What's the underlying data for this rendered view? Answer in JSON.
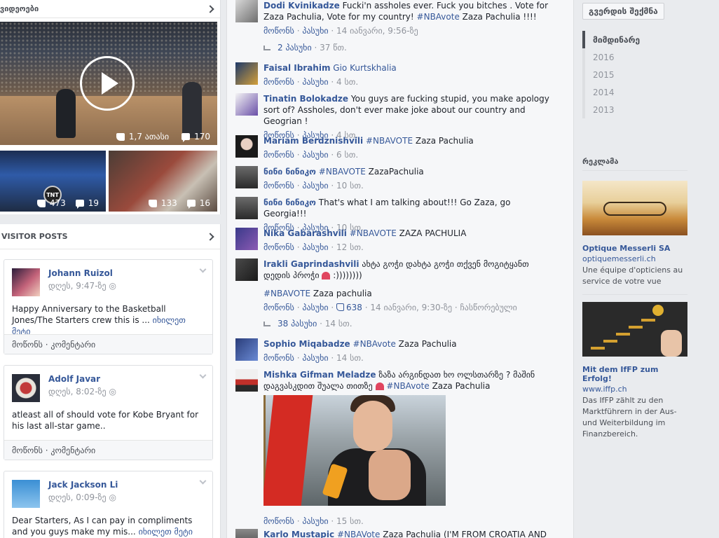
{
  "videos": {
    "section_title": "ვიდეოები",
    "main": {
      "likes": "1,7 ათასი",
      "comments": "170"
    },
    "small": [
      {
        "likes": "473",
        "comments": "19"
      },
      {
        "likes": "133",
        "comments": "16"
      }
    ],
    "tnt_label": "TNT"
  },
  "visitor_posts": {
    "section_title": "VISITOR POSTS",
    "posts": [
      {
        "author": "Johann Ruizol",
        "time": "დღეს, 9:47-ზე",
        "text": "Happy Anniversary to the Basketball Jones/The Starters crew this is ...",
        "see_more": "იხილეთ მეტი",
        "like": "მოწონს",
        "comment": "კომენტარი"
      },
      {
        "author": "Adolf Javar",
        "time": "დღეს, 8:02-ზე",
        "text": "atleast all of should vote for Kobe Bryant for his last all-star game..",
        "see_more": "",
        "like": "მოწონს",
        "comment": "კომენტარი"
      },
      {
        "author": "Jack Jackson Li",
        "time": "დღეს, 0:09-ზე",
        "text": "Dear Starters, As I can pay in compliments and you guys make my mis...",
        "see_more": "იხილეთ მეტი",
        "like": "მოწონს",
        "comment": "კომენტარი"
      }
    ]
  },
  "comments": [
    {
      "name": "Dodi Kvinikadze",
      "tag": "",
      "text": "Fucki'n assholes ever. Fuck you bitches . Vote for Zaza Pachulia, Vote for my country!",
      "tag2": "#NBAvote",
      "text2": "Zaza Pachulia !!!!",
      "actions": {
        "like": "მოწონს",
        "reply": "პასუხი",
        "meta": "14 იანვარი, 9:56-ზე"
      },
      "replies": "2 პასუხი",
      "replies_time": "37 წთ."
    },
    {
      "name": "Faisal Ibrahim",
      "tag": "Gio Kurtskhalia",
      "text": "",
      "actions": {
        "like": "მოწონს",
        "reply": "პასუხი",
        "meta": "4 სთ."
      }
    },
    {
      "name": "Tinatin Bolokadze",
      "tag": "",
      "text": "You guys are fucking stupid, you make apology sort of? Assholes, don't ever make joke about our country and Geogrian !",
      "actions": {
        "like": "მოწონს",
        "reply": "პასუხი",
        "meta": "4 სთ."
      }
    },
    {
      "name": "Mariam Berdznishvili",
      "tag": "#NBAVOTE",
      "text": "Zaza Pachulia",
      "actions": {
        "like": "მოწონს",
        "reply": "პასუხი",
        "meta": "6 სთ."
      }
    },
    {
      "name": "ნინი ნინიკო",
      "tag": "#NBAVOTE",
      "text": "ZazaPachulia",
      "actions": {
        "like": "მოწონს",
        "reply": "პასუხი",
        "meta": "10 სთ."
      }
    },
    {
      "name": "ნინი ნინიკო",
      "tag": "",
      "text": "That's what I am talking about!!! Go Zaza, go Georgia!!!",
      "actions": {
        "like": "მოწონს",
        "reply": "პასუხი",
        "meta": "10 სთ."
      }
    },
    {
      "name": "Nika Gabarashvili",
      "tag": "#NBAVOTE",
      "text": "ZAZA PACHULIA",
      "actions": {
        "like": "მოწონს",
        "reply": "პასუხი",
        "meta": "12 სთ."
      }
    },
    {
      "name": "Irakli Gaprindashvili",
      "tag": "",
      "text": "ახტა გოჭი დახტა გოჭი თქვენ მოგიტყანთ დედის პროჭი",
      "text_after_heart": ":))))))))",
      "tag2": "#NBAVOTE",
      "text2": "Zaza pachulia",
      "actions": {
        "like": "მოწონს",
        "reply": "პასუხი",
        "likes": "638",
        "meta": "14 იანვარი, 9:30-ზე",
        "edited": "ჩასწორებული"
      },
      "replies": "38 პასუხი",
      "replies_time": "14 სთ."
    },
    {
      "name": "Sophio Miqabadze",
      "tag": "#NBAvote",
      "text": "Zaza Pachulia",
      "actions": {
        "like": "მოწონს",
        "reply": "პასუხი",
        "meta": "14 სთ."
      }
    },
    {
      "name": "Mishka Gifman Meladze",
      "tag": "",
      "text": "ზაზა არგინდათ ხო ოლსთარზე ? მაშინ დაგვასკდით შუალა თითზე",
      "tag2": "#NBAvote",
      "text2": "Zaza Pachulia",
      "actions": {
        "like": "მოწონს",
        "reply": "პასუხი",
        "meta": "15 სთ."
      }
    },
    {
      "name": "Karlo Mustapic",
      "tag": "#NBAVote",
      "text": "Zaza Pachulia (I'M FROM CROATIA AND WHY"
    }
  ],
  "right": {
    "create_page": "გვერდის შექმნა",
    "years": [
      "მიმდინარე",
      "2016",
      "2015",
      "2014",
      "2013"
    ],
    "ads_title": "რეკლამა",
    "ads": [
      {
        "title": "Optique Messerli SA",
        "url": "optiquemesserli.ch",
        "desc": "Une équipe d'opticiens au service de votre vue"
      },
      {
        "title": "Mit dem IfFP zum Erfolg!",
        "url": "www.iffp.ch",
        "desc": "Das IfFP zählt zu den Marktführern in der Aus- und Weiterbildung im Finanzbereich."
      }
    ]
  },
  "colors": {
    "link": "#365899",
    "meta": "#90949c",
    "bg": "#e9ebee",
    "heart": "#e0455f"
  }
}
